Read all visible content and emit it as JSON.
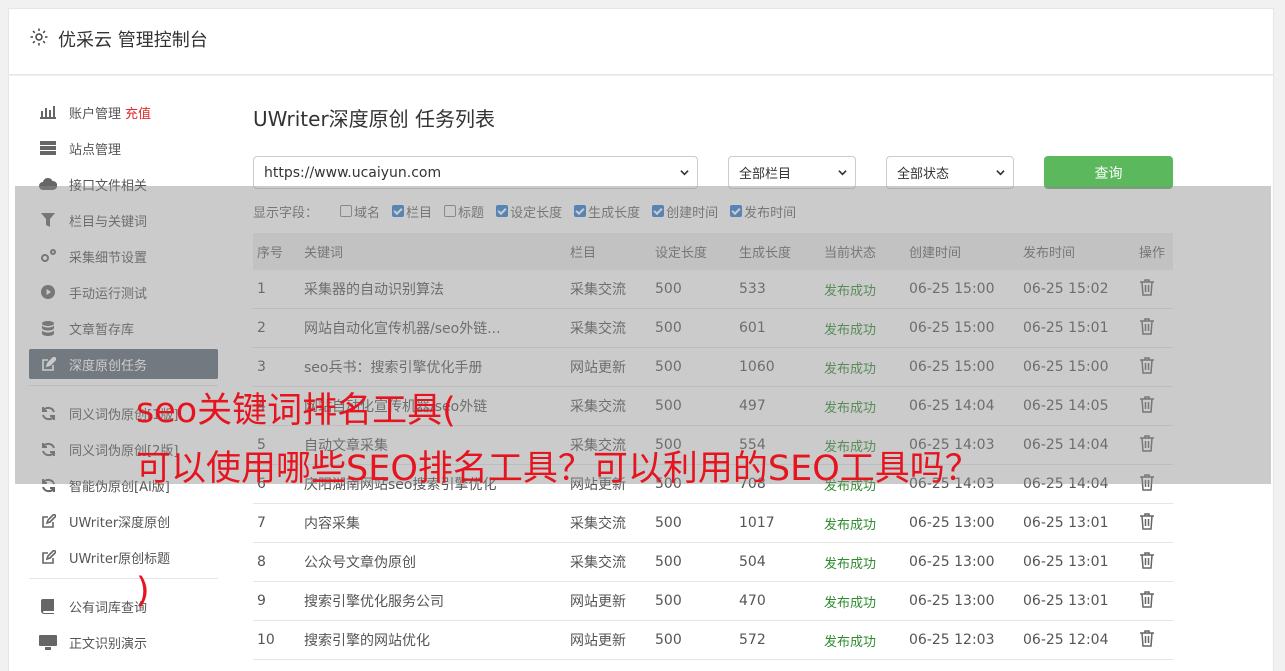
{
  "header": {
    "title": "优采云 管理控制台",
    "icon": "gear-icon"
  },
  "sidebar": {
    "items": [
      {
        "label": "账户管理",
        "badge": "充值",
        "icon": "chart-icon"
      },
      {
        "label": "站点管理",
        "icon": "server-icon"
      },
      {
        "label": "接口文件相关",
        "icon": "cloud-upload-icon"
      },
      {
        "label": "栏目与关键词",
        "icon": "filter-icon"
      },
      {
        "label": "采集细节设置",
        "icon": "cogs-icon"
      },
      {
        "label": "手动运行测试",
        "icon": "play-icon"
      },
      {
        "label": "文章暂存库",
        "icon": "database-icon"
      },
      {
        "label": "深度原创任务",
        "icon": "edit-icon",
        "active": true
      }
    ],
    "items2": [
      {
        "label": "同义词伪原创[1版]",
        "icon": "refresh-icon"
      },
      {
        "label": "同义词伪原创[2版]",
        "icon": "refresh-icon"
      },
      {
        "label": "智能伪原创[AI版]",
        "icon": "refresh-icon"
      },
      {
        "label": "UWriter深度原创",
        "icon": "edit-icon"
      },
      {
        "label": "UWriter原创标题",
        "icon": "edit-icon"
      }
    ],
    "items3": [
      {
        "label": "公有词库查询",
        "icon": "book-icon"
      },
      {
        "label": "正文识别演示",
        "icon": "monitor-icon"
      }
    ]
  },
  "main": {
    "title": "UWriter深度原创 任务列表",
    "site_select": "https://www.ucaiyun.com",
    "column_select": "全部栏目",
    "status_select": "全部状态",
    "query_button": "查询",
    "fields_label": "显示字段：",
    "fields": [
      {
        "label": "域名",
        "checked": false
      },
      {
        "label": "栏目",
        "checked": true
      },
      {
        "label": "标题",
        "checked": false
      },
      {
        "label": "设定长度",
        "checked": true
      },
      {
        "label": "生成长度",
        "checked": true
      },
      {
        "label": "创建时间",
        "checked": true
      },
      {
        "label": "发布时间",
        "checked": true
      }
    ],
    "columns": [
      "序号",
      "关键词",
      "栏目",
      "设定长度",
      "生成长度",
      "当前状态",
      "创建时间",
      "发布时间",
      "操作"
    ],
    "rows": [
      [
        "1",
        "采集器的自动识别算法",
        "采集交流",
        "500",
        "533",
        "发布成功",
        "06-25 15:00",
        "06-25 15:02"
      ],
      [
        "2",
        "网站自动化宣传机器/seo外链...",
        "采集交流",
        "500",
        "601",
        "发布成功",
        "06-25 15:00",
        "06-25 15:01"
      ],
      [
        "3",
        "seo兵书：搜索引擎优化手册",
        "网站更新",
        "500",
        "1060",
        "发布成功",
        "06-25 15:00",
        "06-25 15:00"
      ],
      [
        "4",
        "网站自动化宣传机器/seo外链",
        "采集交流",
        "500",
        "497",
        "发布成功",
        "06-25 14:04",
        "06-25 14:05"
      ],
      [
        "5",
        "自动文章采集",
        "采集交流",
        "500",
        "554",
        "发布成功",
        "06-25 14:03",
        "06-25 14:04"
      ],
      [
        "6",
        "庆阳湖南网站seo搜索引擎优化",
        "网站更新",
        "500",
        "708",
        "发布成功",
        "06-25 14:03",
        "06-25 14:04"
      ],
      [
        "7",
        "内容采集",
        "采集交流",
        "500",
        "1017",
        "发布成功",
        "06-25 13:00",
        "06-25 13:01"
      ],
      [
        "8",
        "公众号文章伪原创",
        "采集交流",
        "500",
        "504",
        "发布成功",
        "06-25 13:00",
        "06-25 13:01"
      ],
      [
        "9",
        "搜索引擎优化服务公司",
        "网站更新",
        "500",
        "470",
        "发布成功",
        "06-25 13:00",
        "06-25 13:01"
      ],
      [
        "10",
        "搜索引擎的网站优化",
        "网站更新",
        "500",
        "572",
        "发布成功",
        "06-25 12:03",
        "06-25 12:04"
      ]
    ]
  },
  "overlay": {
    "line1": "seo关键词排名工具(",
    "line2": "可以使用哪些SEO排名工具？可以利用的SEO工具吗？",
    "line3": ")"
  }
}
